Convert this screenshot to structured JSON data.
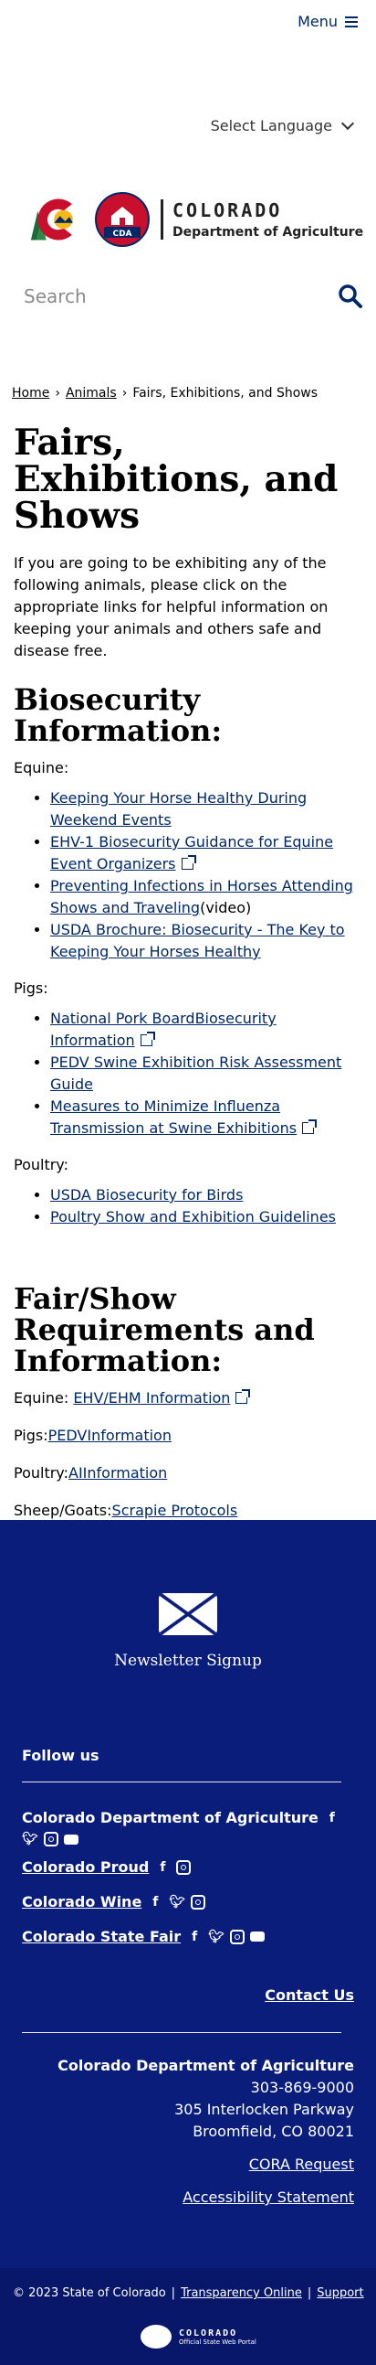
{
  "header": {
    "menu_label": "Menu",
    "language_label": "Select Language",
    "logo": {
      "state": "COLORADO",
      "department": "Department of Agriculture",
      "seal_text": "CDA"
    },
    "search_placeholder": "Search"
  },
  "breadcrumb": {
    "home": "Home",
    "animals": "Animals",
    "current": "Fairs, Exhibitions, and Shows",
    "separator": "›"
  },
  "page": {
    "title": "Fairs, Exhibitions, and Shows",
    "intro": "If you are going to be exhibiting any of the following animals, please click on the appropriate links for helpful information on keeping your animals and others safe and disease free."
  },
  "biosecurity": {
    "heading": "Biosecurity Information:",
    "equine_label": "Equine:",
    "equine_links": [
      "Keeping Your Horse Healthy During Weekend Events",
      "EHV-1 Biosecurity Guidance for Equine Event Organizers",
      "Preventing Infections in Horses Attending Shows and Traveling",
      "USDA Brochure: Biosecurity - The Key to Keeping Your Horses Healthy"
    ],
    "video_suffix": "(video)",
    "pigs_label": "Pigs:",
    "pigs_links": [
      "National Pork BoardBiosecurity Information",
      "PEDV Swine Exhibition Risk Assessment Guide",
      "Measures to Minimize Influenza Transmission at Swine Exhibitions"
    ],
    "poultry_label": "Poultry:",
    "poultry_links": [
      "USDA Biosecurity for Birds",
      "Poultry Show and Exhibition Guidelines"
    ]
  },
  "requirements": {
    "heading": "Fair/Show Requirements and Information:",
    "equine_label": "Equine: ",
    "equine_link": "EHV/EHM Information",
    "pigs_label": "Pigs:",
    "pigs_link": "PEDVInformation",
    "poultry_label": "Poultry:",
    "poultry_link": "AIInformation",
    "sheep_label": "Sheep/Goats:",
    "sheep_link": "Scrapie Protocols"
  },
  "footer": {
    "newsletter": "Newsletter Signup",
    "follow_us": "Follow us",
    "socials": [
      "Colorado Department of Agriculture",
      "Colorado Proud",
      "Colorado Wine",
      "Colorado State Fair"
    ],
    "contact": "Contact Us",
    "org_name": "Colorado Department of Agriculture",
    "phone": "303-869-9000",
    "address_line1": "305 Interlocken Parkway",
    "address_line2": "Broomfield, CO 80021",
    "cora": "CORA Request",
    "accessibility": "Accessibility Statement",
    "copyright": "© 2023 State of Colorado",
    "transparency": "Transparency Online",
    "support": "Support",
    "portal_name": "COLORADO",
    "portal_sub": "Official State Web Portal"
  },
  "colors": {
    "link": "#002868",
    "footer_bg": "#0a1d7a",
    "bottom_bg": "#081769"
  }
}
